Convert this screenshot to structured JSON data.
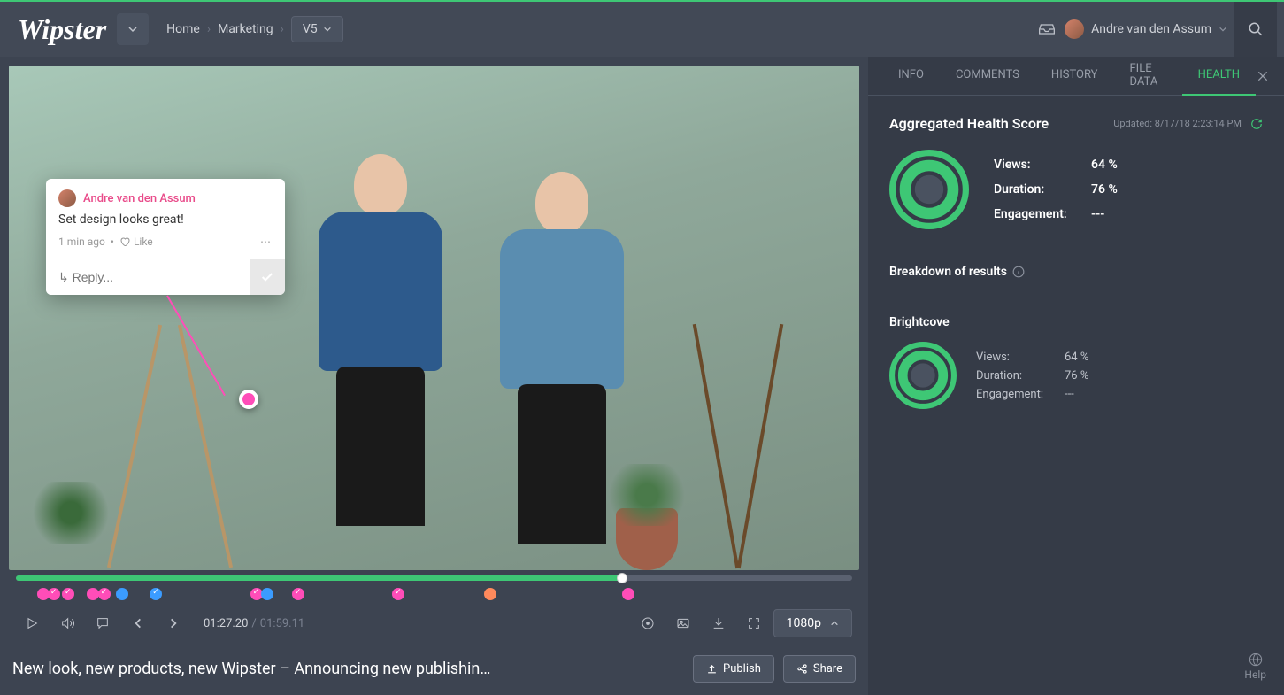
{
  "header": {
    "logo": "Wipster",
    "breadcrumbs": [
      "Home",
      "Marketing"
    ],
    "version": "V5",
    "user_name": "Andre van den Assum"
  },
  "video": {
    "title": "New look, new products, new Wipster – Announcing new publishin…",
    "current_time": "01:27.20",
    "total_time": "01:59.11",
    "quality": "1080p",
    "publish_label": "Publish",
    "share_label": "Share"
  },
  "comment": {
    "author": "Andre van den Assum",
    "body": "Set design looks great!",
    "time_ago": "1 min ago",
    "like_label": "Like",
    "reply_placeholder": "↳ Reply..."
  },
  "tabs": {
    "items": [
      "INFO",
      "COMMENTS",
      "HISTORY",
      "FILE DATA",
      "HEALTH"
    ],
    "active_index": 4
  },
  "health": {
    "title": "Aggregated Health Score",
    "updated": "Updated: 8/17/18 2:23:14 PM",
    "stats": {
      "views_label": "Views:",
      "views_value": "64 %",
      "duration_label": "Duration:",
      "duration_value": "76 %",
      "engagement_label": "Engagement:",
      "engagement_value": "---"
    },
    "breakdown_title": "Breakdown of results",
    "provider": {
      "name": "Brightcove",
      "views_label": "Views:",
      "views_value": "64 %",
      "duration_label": "Duration:",
      "duration_value": "76 %",
      "engagement_label": "Engagement:",
      "engagement_value": "---"
    }
  },
  "help_label": "Help",
  "colors": {
    "accent_green": "#3ec775",
    "accent_pink": "#ff4db8"
  },
  "markers": [
    {
      "pos": 2.5,
      "color": "m-pink",
      "check": false
    },
    {
      "pos": 3.8,
      "color": "m-pink",
      "check": true
    },
    {
      "pos": 5.5,
      "color": "m-pink",
      "check": true
    },
    {
      "pos": 8.5,
      "color": "m-pink",
      "check": false
    },
    {
      "pos": 9.8,
      "color": "m-pink",
      "check": true
    },
    {
      "pos": 12,
      "color": "m-blue",
      "check": false
    },
    {
      "pos": 16,
      "color": "m-blue",
      "check": true
    },
    {
      "pos": 28,
      "color": "m-pink",
      "check": true
    },
    {
      "pos": 29.3,
      "color": "m-blue",
      "check": false
    },
    {
      "pos": 33,
      "color": "m-pink",
      "check": true
    },
    {
      "pos": 45,
      "color": "m-pink",
      "check": true
    },
    {
      "pos": 56,
      "color": "m-orange",
      "check": false
    },
    {
      "pos": 72.5,
      "color": "m-pink",
      "check": false
    }
  ]
}
